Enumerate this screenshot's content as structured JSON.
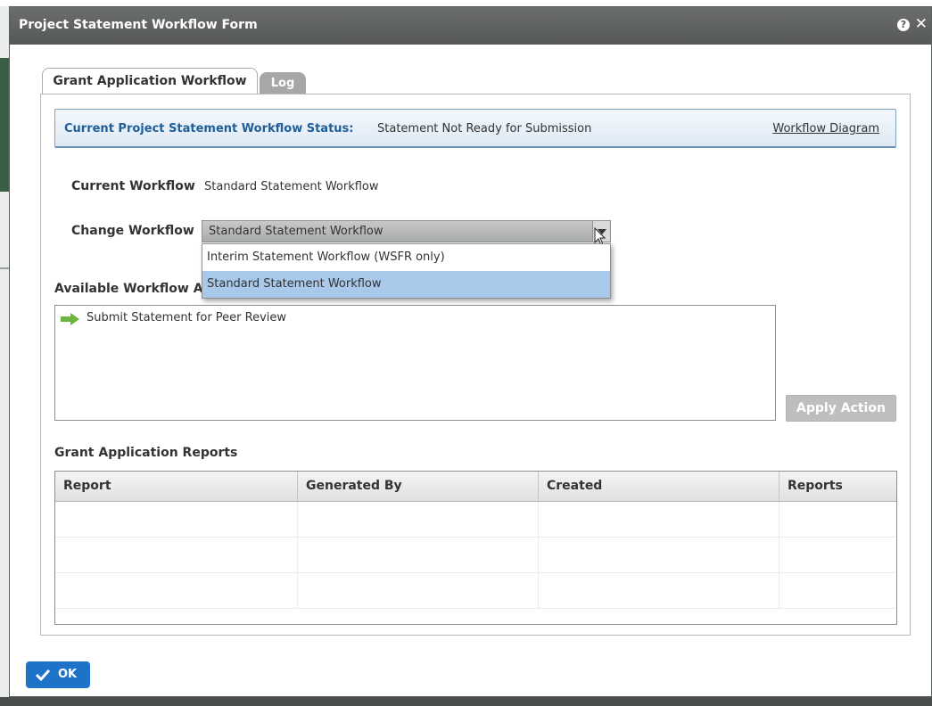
{
  "dialog": {
    "title": "Project Statement Workflow Form",
    "help_icon": "question-mark-icon",
    "close_icon": "close-icon"
  },
  "tabs": [
    {
      "label": "Grant Application Workflow",
      "active": true
    },
    {
      "label": "Log",
      "active": false
    }
  ],
  "status": {
    "label": "Current Project Statement Workflow Status:",
    "value": "Statement Not Ready for Submission",
    "diagram_link": "Workflow Diagram"
  },
  "current_workflow": {
    "label": "Current Workflow",
    "value": "Standard Statement Workflow"
  },
  "change_workflow": {
    "label": "Change Workflow",
    "selected": "Standard Statement Workflow",
    "options": [
      {
        "label": "Interim Statement Workflow (WSFR only)",
        "highlighted": false
      },
      {
        "label": "Standard Statement Workflow",
        "highlighted": true
      }
    ]
  },
  "actions": {
    "label": "Available Workflow A",
    "items": [
      {
        "label": "Submit Statement for Peer Review",
        "icon": "green-arrow-icon"
      }
    ],
    "apply_label": "Apply Action"
  },
  "reports": {
    "title": "Grant Application Reports",
    "columns": [
      "Report",
      "Generated By",
      "Created",
      "Reports"
    ],
    "rows": [
      [
        "",
        "",
        "",
        ""
      ],
      [
        "",
        "",
        "",
        ""
      ],
      [
        "",
        "",
        "",
        ""
      ]
    ]
  },
  "footer": {
    "ok_label": "OK"
  },
  "colors": {
    "titlebar": "#555856",
    "status_label": "#1f5f99",
    "highlight": "#a9c9ea",
    "ok_button": "#1e73c9",
    "action_arrow": "#6cb33f"
  }
}
